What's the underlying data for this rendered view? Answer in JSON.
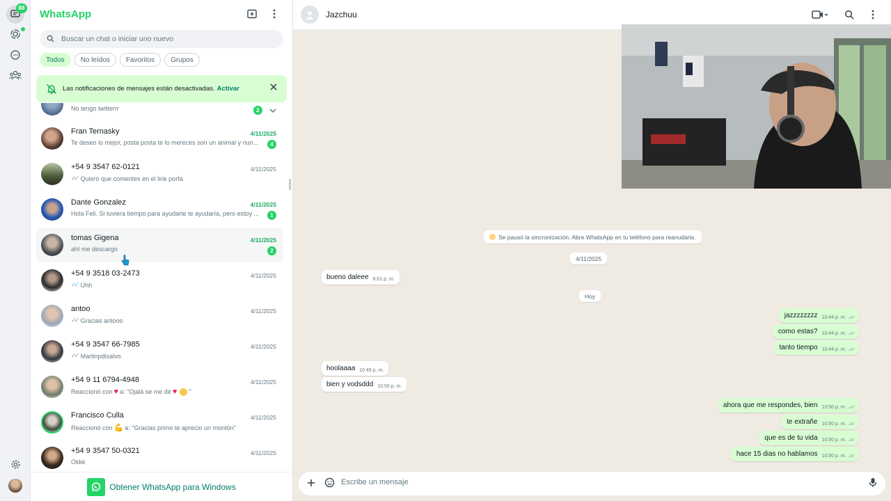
{
  "rail": {
    "chats_badge": "88"
  },
  "app": {
    "title": "WhatsApp"
  },
  "search": {
    "placeholder": "Buscar un chat o iniciar uno nuevo"
  },
  "filters": [
    "Todos",
    "No leídos",
    "Favoritos",
    "Grupos"
  ],
  "notice": {
    "text": "Las notificaciones de mensajes están desactivadas.",
    "action": "Activar"
  },
  "chats": [
    {
      "name": "",
      "preview": "No tengo twitterrr",
      "date": "",
      "unread": "2"
    },
    {
      "name": "Fran Ternasky",
      "preview": "Te deseo lo mejor, posta posta te lo mereces son un animal y nun...",
      "date": "4/11/2025",
      "unread": "4"
    },
    {
      "name": "+54 9 3547 62-0121",
      "preview": "Quiero que comentes en el link porfa",
      "date": "4/11/2025",
      "unread": ""
    },
    {
      "name": "Dante Gonzalez",
      "preview": "Hola Feli. Si tuviera tiempo para ayudarte te ayudaría, pero estoy ...",
      "date": "4/11/2025",
      "unread": "1"
    },
    {
      "name": "tomas Gigena",
      "preview": "ahí me descargo",
      "date": "4/11/2025",
      "unread": "2"
    },
    {
      "name": "+54 9 3518 03-2473",
      "preview": "Uhh",
      "date": "4/11/2025",
      "unread": ""
    },
    {
      "name": "antoo",
      "preview": "Gracias antooo",
      "date": "4/11/2025",
      "unread": ""
    },
    {
      "name": "+54 9 3547 66-7985",
      "preview": "Martinpdisalvo",
      "date": "4/11/2025",
      "unread": ""
    },
    {
      "name": "+54 9 11 6794-4948",
      "preview_a": "Reaccionó con",
      "preview_b": "a: \"Ojalá se me dé",
      "date": "4/11/2025",
      "unread": ""
    },
    {
      "name": "Francisco Culla",
      "preview_a": "Reaccionó con",
      "preview_b": "a: \"Gracias primo te aprecio un montón\"",
      "date": "4/11/2025",
      "unread": ""
    },
    {
      "name": "+54 9 3547 50-0321",
      "preview": "Okkk",
      "date": "4/11/2025",
      "unread": ""
    }
  ],
  "get_app": {
    "label": "Obtener WhatsApp para Windows"
  },
  "conversation": {
    "contact_name": "Jazchuu",
    "system_notice": "Se pausó la sincronización. Abre WhatsApp en tu teléfono para reanudarla.",
    "date_1": "4/11/2025",
    "date_2": "Hoy",
    "messages": [
      {
        "dir": "in",
        "text": "bueno daleee",
        "time": "6:01 p. m."
      },
      {
        "dir": "out",
        "text": "jazzzzzzzz",
        "time": "10:44 p. m."
      },
      {
        "dir": "out",
        "text": "como estas?",
        "time": "10:44 p. m."
      },
      {
        "dir": "out",
        "text": "tanto tiempo",
        "time": "10:44 p. m."
      },
      {
        "dir": "in",
        "text": "hoolaaaa",
        "time": "10:49 p. m."
      },
      {
        "dir": "in",
        "text": "bien y vodsddd",
        "time": "10:50 p. m."
      },
      {
        "dir": "out",
        "text": "ahora que me respondes, bien",
        "time": "10:50 p. m."
      },
      {
        "dir": "out",
        "text": "te extrañe",
        "time": "10:50 p. m."
      },
      {
        "dir": "out",
        "text": "que es de tu vida",
        "time": "10:50 p. m."
      },
      {
        "dir": "out",
        "text": "hace 15 dias no hablamos",
        "time": "10:50 p. m."
      }
    ],
    "composer_placeholder": "Escribe un mensaje"
  },
  "colors": {
    "brand": "#25d366",
    "accent": "#008069",
    "outgoing_bubble": "#d9fdd3",
    "chat_bg": "#efeae2"
  }
}
